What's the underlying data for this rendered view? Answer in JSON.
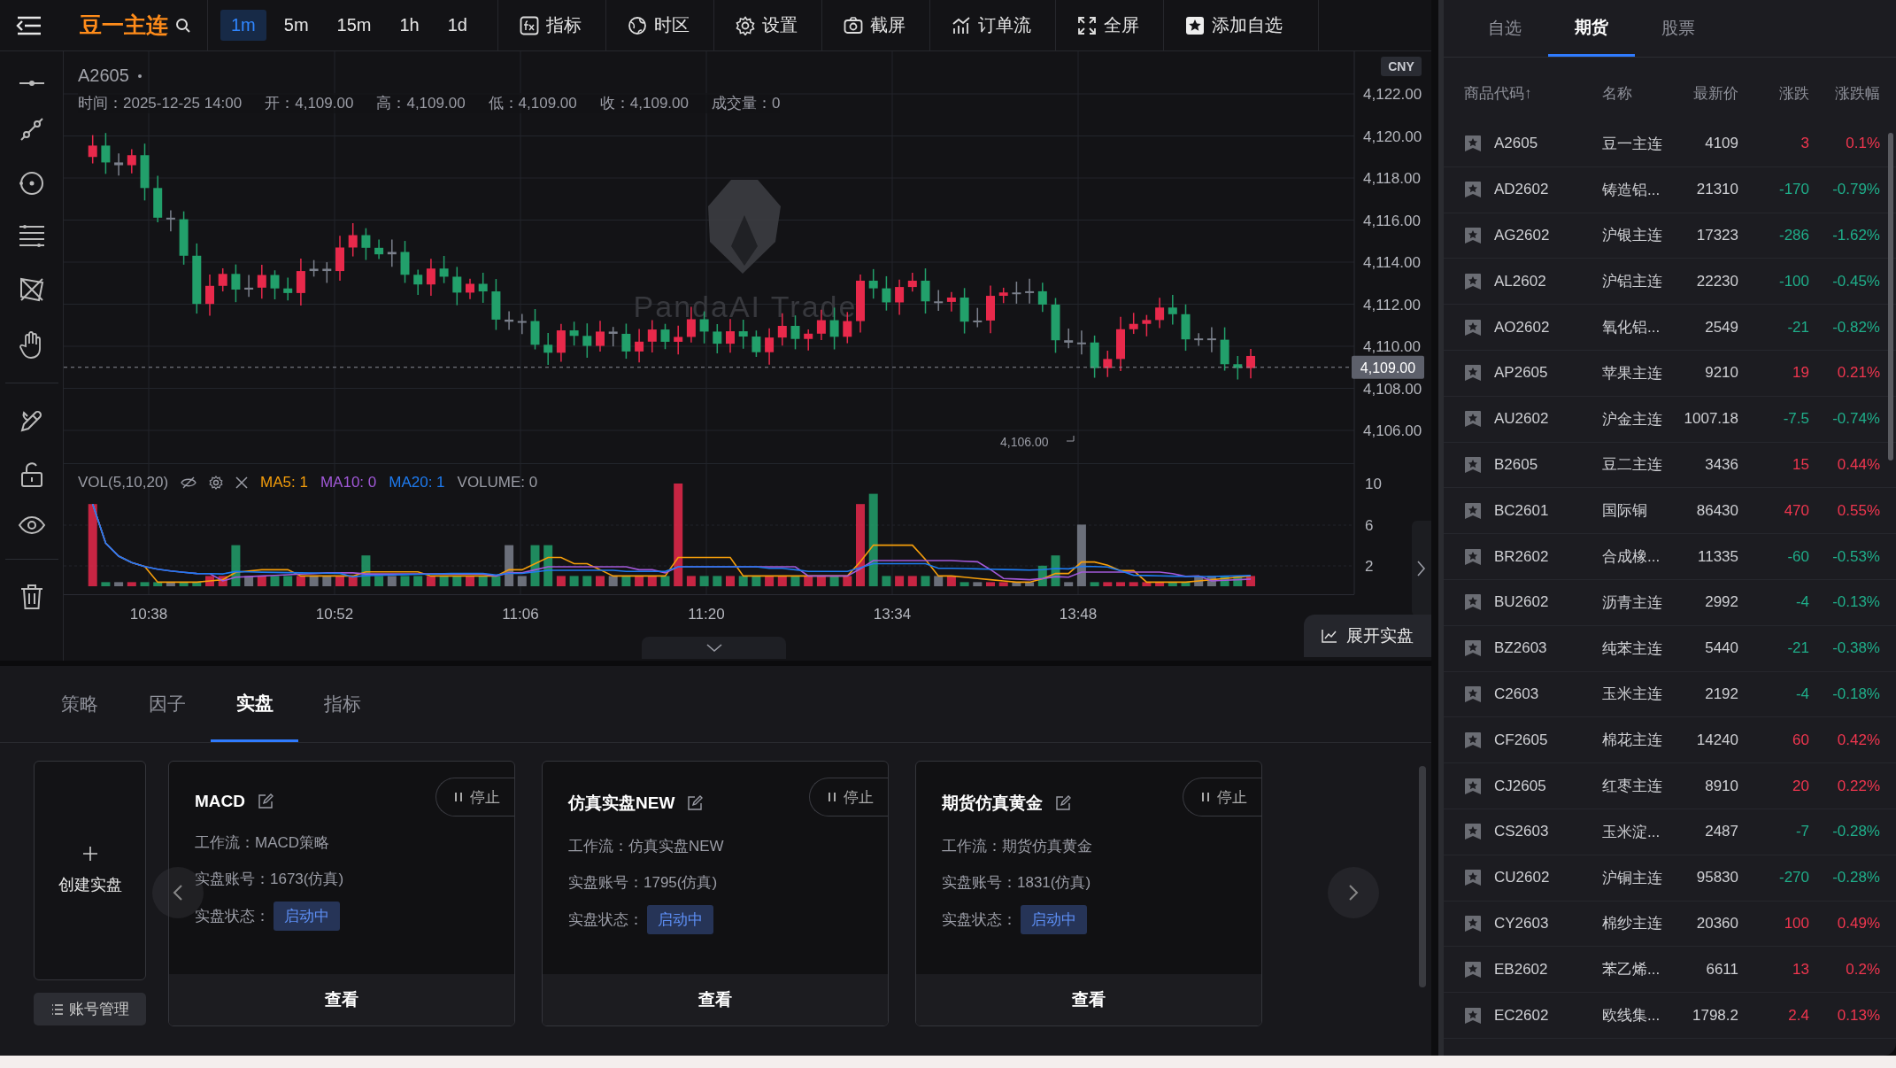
{
  "top_bar": {
    "symbol": "豆一主连",
    "intervals": [
      {
        "label": "1m",
        "selected": true
      },
      {
        "label": "5m",
        "selected": false
      },
      {
        "label": "15m",
        "selected": false
      },
      {
        "label": "1h",
        "selected": false
      },
      {
        "label": "1d",
        "selected": false
      }
    ],
    "tools": [
      {
        "kind": "indicator",
        "label": "指标"
      },
      {
        "kind": "timezone",
        "label": "时区"
      },
      {
        "kind": "settings",
        "label": "设置"
      },
      {
        "kind": "screenshot",
        "label": "截屏"
      },
      {
        "kind": "orderflow",
        "label": "订单流"
      },
      {
        "kind": "fullscreen",
        "label": "全屏"
      },
      {
        "kind": "favorite",
        "label": "添加自选"
      }
    ]
  },
  "chart": {
    "symbol": "A2605",
    "ohlc": [
      "时间：2025-12-25 14:00",
      "开：4,109.00",
      "高：4,109.00",
      "低：4,109.00",
      "收：4,109.00",
      "成交量：0"
    ],
    "currency": "CNY",
    "price_ticks": [
      "4,122.00",
      "4,120.00",
      "4,118.00",
      "4,116.00",
      "4,114.00",
      "4,112.00",
      "4,110.00",
      "4,108.00",
      "4,106.00"
    ],
    "current_price": "4,109.00",
    "low_marker": "4,106.00",
    "watermark": "PandaAI Trade",
    "volume": {
      "title": "VOL(5,10,20)",
      "ma": [
        {
          "label": "MA5: 1",
          "color": "#f59e0b"
        },
        {
          "label": "MA10: 0",
          "color": "#a259d9"
        },
        {
          "label": "MA20: 1",
          "color": "#1e7bf0"
        }
      ],
      "reading": "VOLUME: 0",
      "ticks": [
        "10",
        "6",
        "2"
      ]
    },
    "time_ticks": [
      "10:38",
      "10:52",
      "11:06",
      "11:20",
      "13:34",
      "13:48"
    ],
    "expand_button": "展开实盘"
  },
  "bottom": {
    "tabs": [
      {
        "label": "策略",
        "selected": false
      },
      {
        "label": "因子",
        "selected": false
      },
      {
        "label": "实盘",
        "selected": true
      },
      {
        "label": "指标",
        "selected": false
      }
    ],
    "create_label": "创建实盘",
    "account_button": "账号管理",
    "cards": [
      {
        "title": "MACD",
        "stop": "停止",
        "fields": [
          "工作流：MACD策略",
          "实盘账号：1673(仿真)"
        ],
        "status_label": "实盘状态：",
        "status": "启动中",
        "view": "查看"
      },
      {
        "title": "仿真实盘NEW",
        "stop": "停止",
        "fields": [
          "工作流：仿真实盘NEW",
          "实盘账号：1795(仿真)"
        ],
        "status_label": "实盘状态：",
        "status": "启动中",
        "view": "查看"
      },
      {
        "title": "期货仿真黄金",
        "stop": "停止",
        "fields": [
          "工作流：期货仿真黄金",
          "实盘账号：1831(仿真)"
        ],
        "status_label": "实盘状态：",
        "status": "启动中",
        "view": "查看"
      }
    ]
  },
  "watchlist": {
    "tabs": [
      {
        "label": "自选",
        "selected": false
      },
      {
        "label": "期货",
        "selected": true
      },
      {
        "label": "股票",
        "selected": false
      }
    ],
    "columns": [
      "商品代码↑",
      "名称",
      "最新价",
      "涨跌",
      "涨跌幅"
    ],
    "rows": [
      {
        "code": "A2605",
        "name": "豆一主连",
        "price": "4109",
        "change": "3",
        "pct": "0.1%",
        "up": true
      },
      {
        "code": "AD2602",
        "name": "铸造铝...",
        "price": "21310",
        "change": "-170",
        "pct": "-0.79%",
        "up": false
      },
      {
        "code": "AG2602",
        "name": "沪银主连",
        "price": "17323",
        "change": "-286",
        "pct": "-1.62%",
        "up": false
      },
      {
        "code": "AL2602",
        "name": "沪铝主连",
        "price": "22230",
        "change": "-100",
        "pct": "-0.45%",
        "up": false
      },
      {
        "code": "AO2602",
        "name": "氧化铝...",
        "price": "2549",
        "change": "-21",
        "pct": "-0.82%",
        "up": false
      },
      {
        "code": "AP2605",
        "name": "苹果主连",
        "price": "9210",
        "change": "19",
        "pct": "0.21%",
        "up": true
      },
      {
        "code": "AU2602",
        "name": "沪金主连",
        "price": "1007.18",
        "change": "-7.5",
        "pct": "-0.74%",
        "up": false
      },
      {
        "code": "B2605",
        "name": "豆二主连",
        "price": "3436",
        "change": "15",
        "pct": "0.44%",
        "up": true
      },
      {
        "code": "BC2601",
        "name": "国际铜",
        "price": "86430",
        "change": "470",
        "pct": "0.55%",
        "up": true
      },
      {
        "code": "BR2602",
        "name": "合成橡...",
        "price": "11335",
        "change": "-60",
        "pct": "-0.53%",
        "up": false
      },
      {
        "code": "BU2602",
        "name": "沥青主连",
        "price": "2992",
        "change": "-4",
        "pct": "-0.13%",
        "up": false
      },
      {
        "code": "BZ2603",
        "name": "纯苯主连",
        "price": "5440",
        "change": "-21",
        "pct": "-0.38%",
        "up": false
      },
      {
        "code": "C2603",
        "name": "玉米主连",
        "price": "2192",
        "change": "-4",
        "pct": "-0.18%",
        "up": false
      },
      {
        "code": "CF2605",
        "name": "棉花主连",
        "price": "14240",
        "change": "60",
        "pct": "0.42%",
        "up": true
      },
      {
        "code": "CJ2605",
        "name": "红枣主连",
        "price": "8910",
        "change": "20",
        "pct": "0.22%",
        "up": true
      },
      {
        "code": "CS2603",
        "name": "玉米淀...",
        "price": "2487",
        "change": "-7",
        "pct": "-0.28%",
        "up": false
      },
      {
        "code": "CU2602",
        "name": "沪铜主连",
        "price": "95830",
        "change": "-270",
        "pct": "-0.28%",
        "up": false
      },
      {
        "code": "CY2603",
        "name": "棉纱主连",
        "price": "20360",
        "change": "100",
        "pct": "0.49%",
        "up": true
      },
      {
        "code": "EB2602",
        "name": "苯乙烯...",
        "price": "6611",
        "change": "13",
        "pct": "0.2%",
        "up": true
      },
      {
        "code": "EC2602",
        "name": "欧线集...",
        "price": "1798.2",
        "change": "2.4",
        "pct": "0.13%",
        "up": true
      }
    ]
  }
}
